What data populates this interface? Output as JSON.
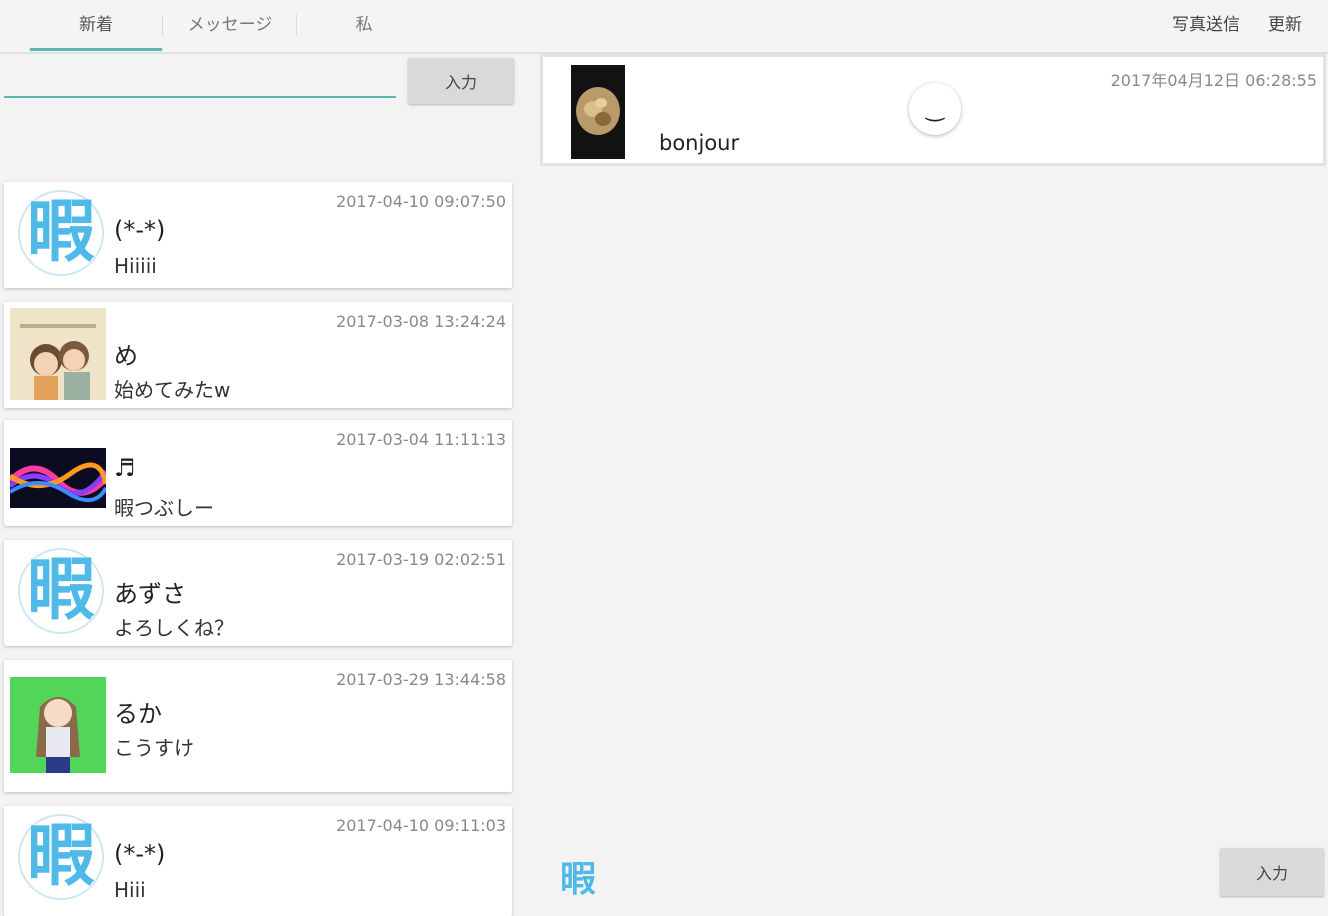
{
  "tabs": [
    "新着",
    "メッセージ",
    "私"
  ],
  "header": {
    "photo_send": "写真送信",
    "refresh": "更新"
  },
  "left": {
    "search_value": "",
    "input_button": "入力",
    "items": [
      {
        "time": "2017-04-10 09:07:50",
        "name": "(*-*)",
        "message": "Hiiiii",
        "avatar": "hima-logo",
        "avatar_char": "暇"
      },
      {
        "time": "2017-03-08 13:24:24",
        "name": "め",
        "message": "始めてみたw",
        "avatar": "anime-couple-image"
      },
      {
        "time": "2017-03-04 11:11:13",
        "name": "♬",
        "message": "暇つぶしー",
        "avatar": "colorful-wave-image"
      },
      {
        "time": "2017-03-19 02:02:51",
        "name": "あずさ",
        "message": "よろしくね？",
        "avatar": "hima-logo",
        "avatar_char": "暇"
      },
      {
        "time": "2017-03-29 13:44:58",
        "name": "るか",
        "message": "こうすけ",
        "avatar": "anime-girl-image"
      },
      {
        "time": "2017-04-10 09:11:03",
        "name": "(*-*)",
        "message": "Hiii",
        "avatar": "hima-logo",
        "avatar_char": "暇"
      }
    ]
  },
  "right": {
    "post_time": "2017年04月12日 06:28:55",
    "post_text": "bonjour",
    "float_button_glyph": "‿",
    "bottom_logo": "暇",
    "input_button": "入力"
  },
  "colors": {
    "accent": "#5bb8b0",
    "logo_blue": "#4fb9e8"
  }
}
